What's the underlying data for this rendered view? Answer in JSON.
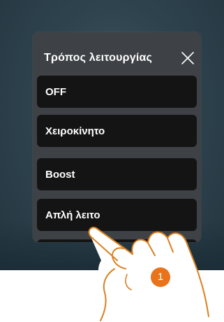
{
  "dialog": {
    "title": "Τρόπος λειτουργίας",
    "close_icon": "close-icon",
    "options": [
      {
        "label": "OFF"
      },
      {
        "label": "Χειροκίνητο"
      },
      {
        "label": "Boost"
      },
      {
        "label": "Απλή λειτο"
      },
      {
        "label": ""
      }
    ]
  },
  "annotation": {
    "step_number": "1",
    "hand_icon": "pointing-hand-icon"
  },
  "colors": {
    "screen_background": "#2f434e",
    "dialog_background": "#3e4246",
    "option_background": "#141414",
    "text": "#ffffff",
    "step_badge": "#e8731a",
    "hand_outline": "#d9801f"
  }
}
